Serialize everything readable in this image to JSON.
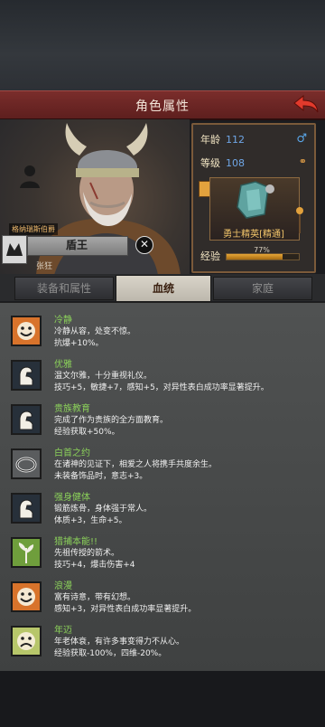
{
  "header": {
    "title": "角色属性"
  },
  "character": {
    "title_tag": "格纳瑞斯伯爵",
    "class_name": "盾王",
    "persona": "张狂",
    "age_label": "年龄",
    "age_value": "112",
    "level_label": "等级",
    "level_value": "108",
    "rank_label": "勇士精英[精通]",
    "xp_label": "经验",
    "xp_text": "77%",
    "xp_progress": 0.77
  },
  "tabs": [
    "装备和属性",
    "血统",
    "家庭"
  ],
  "active_tab": 1,
  "traits": [
    {
      "name": "冷静",
      "desc": "冷静从容，处变不惊。",
      "effect": "抗爆+10%。",
      "icon": "smiley-icon"
    },
    {
      "name": "优雅",
      "desc": "温文尔雅，十分重视礼仪。",
      "effect": "技巧+5，敏捷+7，感知+5，对异性表白成功率显著提升。",
      "icon": "arm-icon"
    },
    {
      "name": "贵族教育",
      "desc": "完成了作为贵族的全方面教育。",
      "effect": "经验获取+50%。",
      "icon": "arm-icon"
    },
    {
      "name": "白首之约",
      "desc": "在诸神的见证下，相爱之人将携手共度余生。",
      "effect": "未装备饰品时，意志+3。",
      "icon": "ring-icon"
    },
    {
      "name": "强身健体",
      "desc": "锻筋炼骨，身体强于常人。",
      "effect": "体质+3，生命+5。",
      "icon": "arm-icon"
    },
    {
      "name": "猎捕本能!!",
      "desc": "先祖传授的箭术。",
      "effect": "技巧+4，爆击伤害+4",
      "icon": "leaf-icon"
    },
    {
      "name": "浪漫",
      "desc": "富有诗意，带有幻想。",
      "effect": "感知+3，对异性表白成功率显著提升。",
      "icon": "smiley-icon"
    },
    {
      "name": "年迈",
      "desc": "年老体衰，有许多事变得力不从心。",
      "effect": "经验获取-100%，四维-20%。",
      "icon": "sad-face-icon"
    }
  ],
  "colors": {
    "accent": "#7a2d2b",
    "trait_name": "#8bd15a",
    "level_value": "#6fa6e6"
  }
}
